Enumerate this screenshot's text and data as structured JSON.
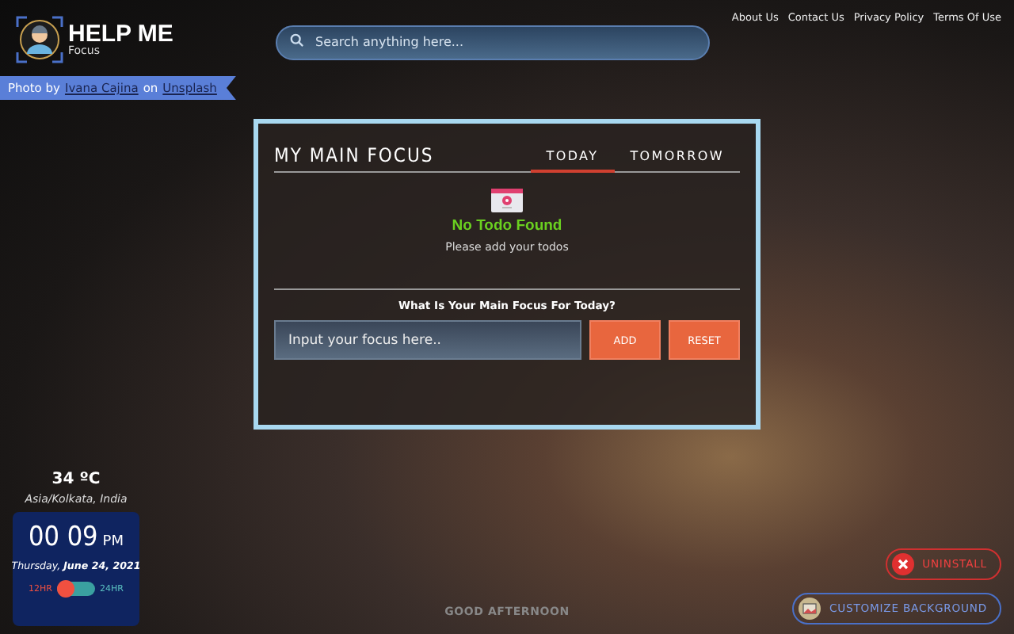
{
  "logo": {
    "title": "HELP ME",
    "subtitle": "Focus"
  },
  "search": {
    "placeholder": "Search anything here..."
  },
  "nav_links": [
    "About Us",
    "Contact Us",
    "Privacy Policy",
    "Terms Of Use"
  ],
  "photo_credit": {
    "prefix": "Photo by",
    "author": "Ivana Cajina",
    "joiner": "on",
    "site": "Unsplash"
  },
  "focus_card": {
    "title": "MY MAIN FOCUS",
    "tabs": [
      {
        "label": "TODAY",
        "selected": true
      },
      {
        "label": "TOMORROW",
        "selected": false
      }
    ],
    "empty_title": "No Todo Found",
    "empty_text": "Please add your todos",
    "question": "What Is Your Main Focus For Today?",
    "input": {
      "placeholder": "Input your focus here.."
    },
    "buttons": [
      "ADD",
      "RESET"
    ]
  },
  "weather": {
    "temperature": "34 ºC",
    "location": "Asia/Kolkata, India"
  },
  "clock": {
    "hours": "00",
    "minutes": "09",
    "period": "PM",
    "weekday": "Thursday,",
    "date": "June 24, 2021",
    "format_labels": [
      "12HR",
      "24HR"
    ],
    "format_24h": false
  },
  "greeting": "GOOD AFTERNOON",
  "actions": [
    {
      "kind": "uninstall",
      "label": "UNINSTALL"
    },
    {
      "kind": "customize",
      "label": "CUSTOMIZE BACKGROUND"
    }
  ]
}
